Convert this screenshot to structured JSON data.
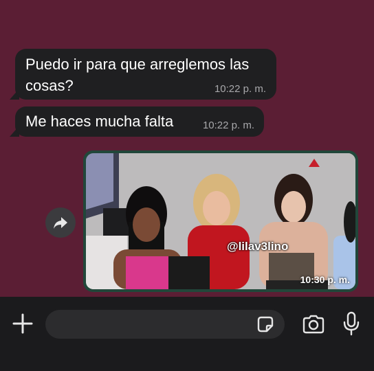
{
  "messages": [
    {
      "text": "Puedo ir para que arreglemos las cosas?",
      "time": "10:22 p. m."
    },
    {
      "text": "Me haces mucha falta",
      "time": "10:22 p. m."
    }
  ],
  "media_message": {
    "watermark": "@lilav3lino",
    "time": "10:30 p. m."
  },
  "icons": {
    "forward": "forward-arrow-icon",
    "attach": "plus-icon",
    "sticker": "sticker-icon",
    "camera": "camera-icon",
    "microphone": "microphone-icon"
  },
  "colors": {
    "background": "#5b1e34",
    "bubble": "#1f1f21",
    "media_border": "#21473a",
    "input_bar": "#1b1b1d"
  }
}
